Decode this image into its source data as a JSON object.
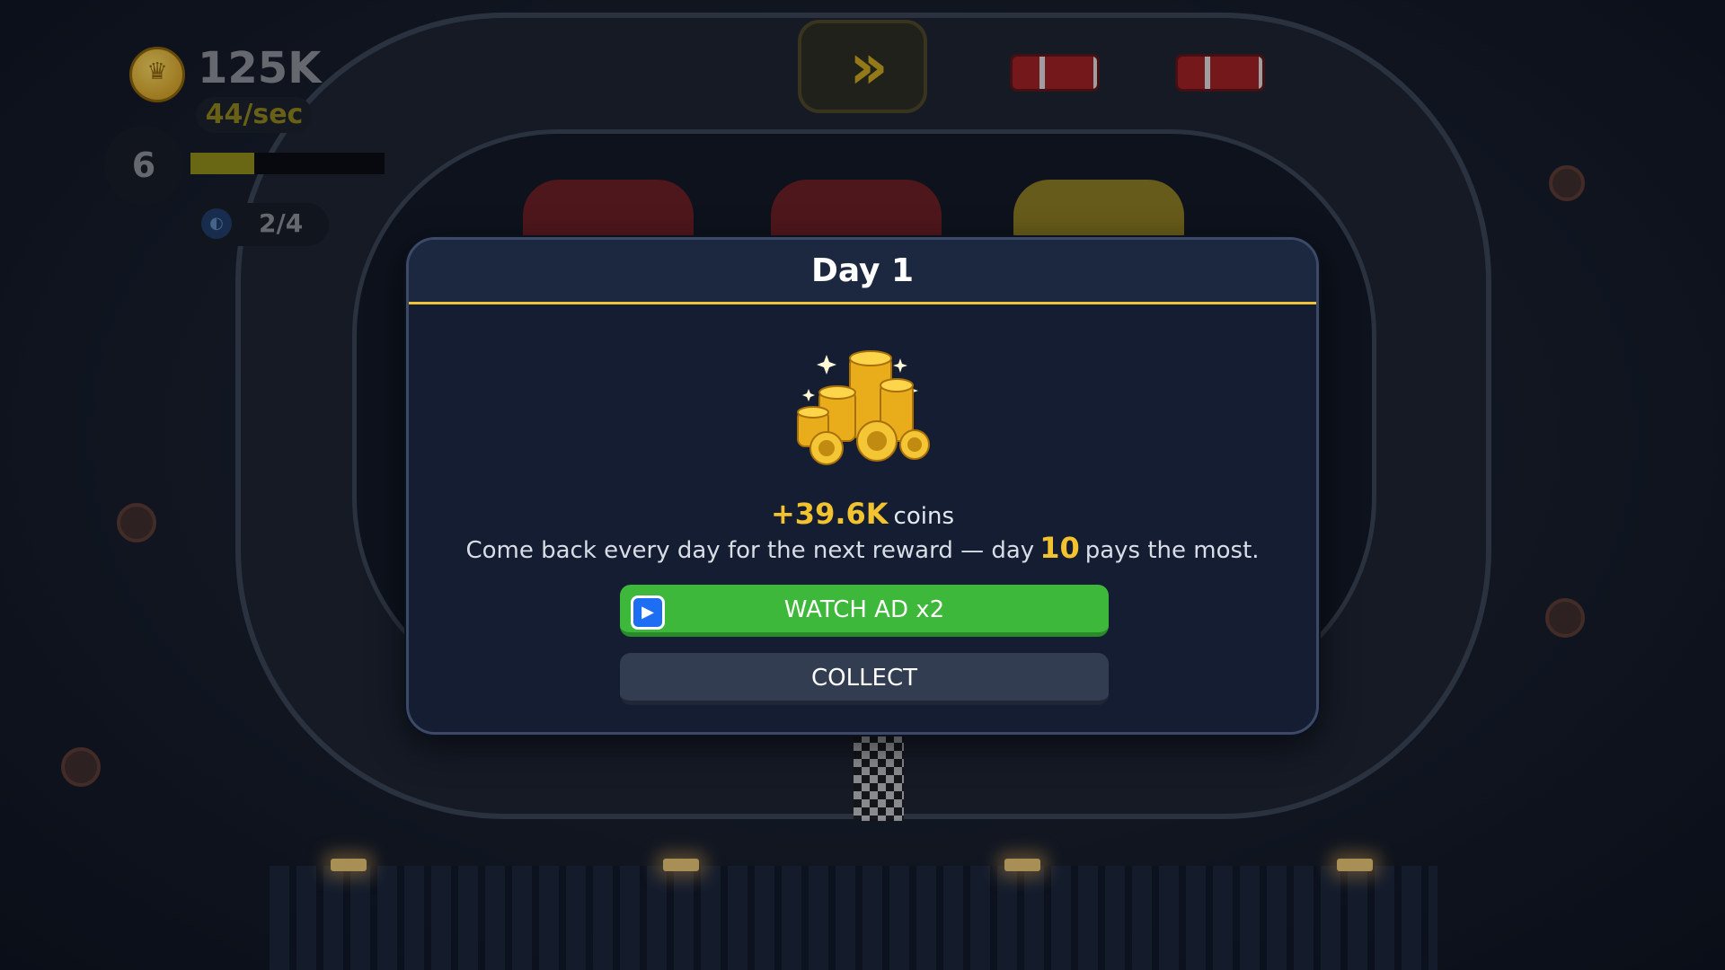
{
  "hud": {
    "coins": "125K",
    "coin_rate": "44/sec",
    "level": "6",
    "level_progress": 0.33,
    "parts": "2/4",
    "coin_icon": "crown-coin-icon",
    "parts_icon": "wrench-badge-icon",
    "speed_icon": "fast-forward-icon"
  },
  "modal": {
    "title": "Day 1",
    "reward_amount": "+39.6K",
    "reward_unit": "coins",
    "info_before": "Come back every day for the next reward — day",
    "info_highlight": "10",
    "info_after": "pays the most.",
    "watch_ad_label": "WATCH AD x2",
    "collect_label": "COLLECT",
    "reward_icon": "coin-stack-icon",
    "ad_icon": "play-video-icon"
  },
  "colors": {
    "accent_gold": "#f3c22f",
    "watch_ad_green": "#3db83a",
    "collect_slate": "#323d52",
    "modal_bg": "#141d31"
  }
}
